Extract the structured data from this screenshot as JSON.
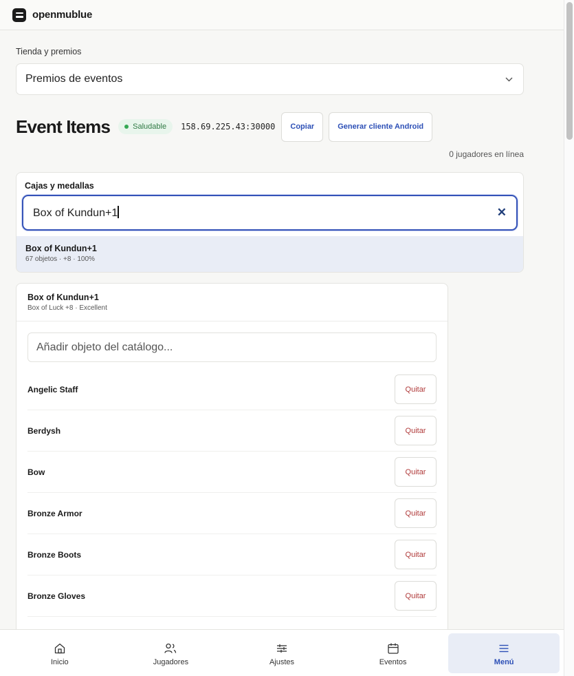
{
  "app": {
    "name": "openmublue"
  },
  "section": {
    "label": "Tienda y premios",
    "select_value": "Premios de eventos"
  },
  "header": {
    "title": "Event Items",
    "status": "Saludable",
    "address": "158.69.225.43:30000",
    "copy_label": "Copiar",
    "android_label": "Generar cliente Android",
    "players_online": "0 jugadores en línea"
  },
  "boxes": {
    "label": "Cajas y medallas",
    "search_value": "Box of Kundun+1",
    "result": {
      "name": "Box of Kundun+1",
      "meta": "67 objetos · +8 · 100%"
    }
  },
  "box_detail": {
    "name": "Box of Kundun+1",
    "meta": "Box of Luck +8 · Excellent",
    "add_placeholder": "Añadir objeto del catálogo...",
    "remove_label": "Quitar",
    "items": [
      "Angelic Staff",
      "Berdysh",
      "Bow",
      "Bronze Armor",
      "Bronze Boots",
      "Bronze Gloves"
    ]
  },
  "nav": {
    "items": [
      {
        "label": "Inicio",
        "icon": "home-icon"
      },
      {
        "label": "Jugadores",
        "icon": "users-icon"
      },
      {
        "label": "Ajustes",
        "icon": "sliders-icon"
      },
      {
        "label": "Eventos",
        "icon": "calendar-icon"
      },
      {
        "label": "Menú",
        "icon": "menu-icon"
      }
    ],
    "active": "Menú"
  }
}
